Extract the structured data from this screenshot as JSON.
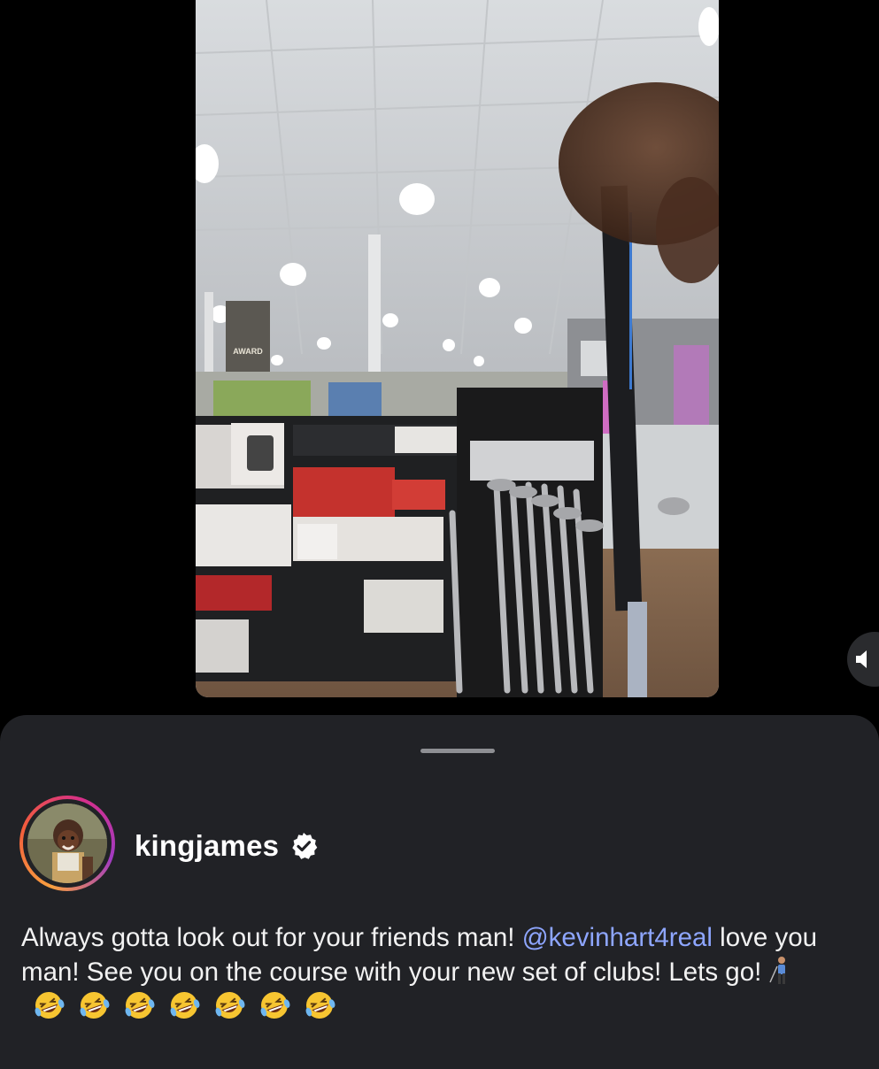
{
  "post": {
    "username": "kingjames",
    "verified": true,
    "caption_text": "Always gotta look out for your friends man! ",
    "mention": "@kevinhart4real",
    "caption_text_2": " love you man! See you on the course with your new set of clubs! Lets go!",
    "emojis": {
      "golfer": "golfer-emoji",
      "laugh_count": 7,
      "laugh": "rolling-on-the-floor-laughing-emoji"
    }
  },
  "video": {
    "banner_text": "AWARD"
  },
  "icons": {
    "sound": "speaker-muted-icon",
    "verified": "verified-badge-icon"
  },
  "colors": {
    "sheet_background": "#212226",
    "mention": "#8ea6ff",
    "text": "#f2f2f2"
  }
}
